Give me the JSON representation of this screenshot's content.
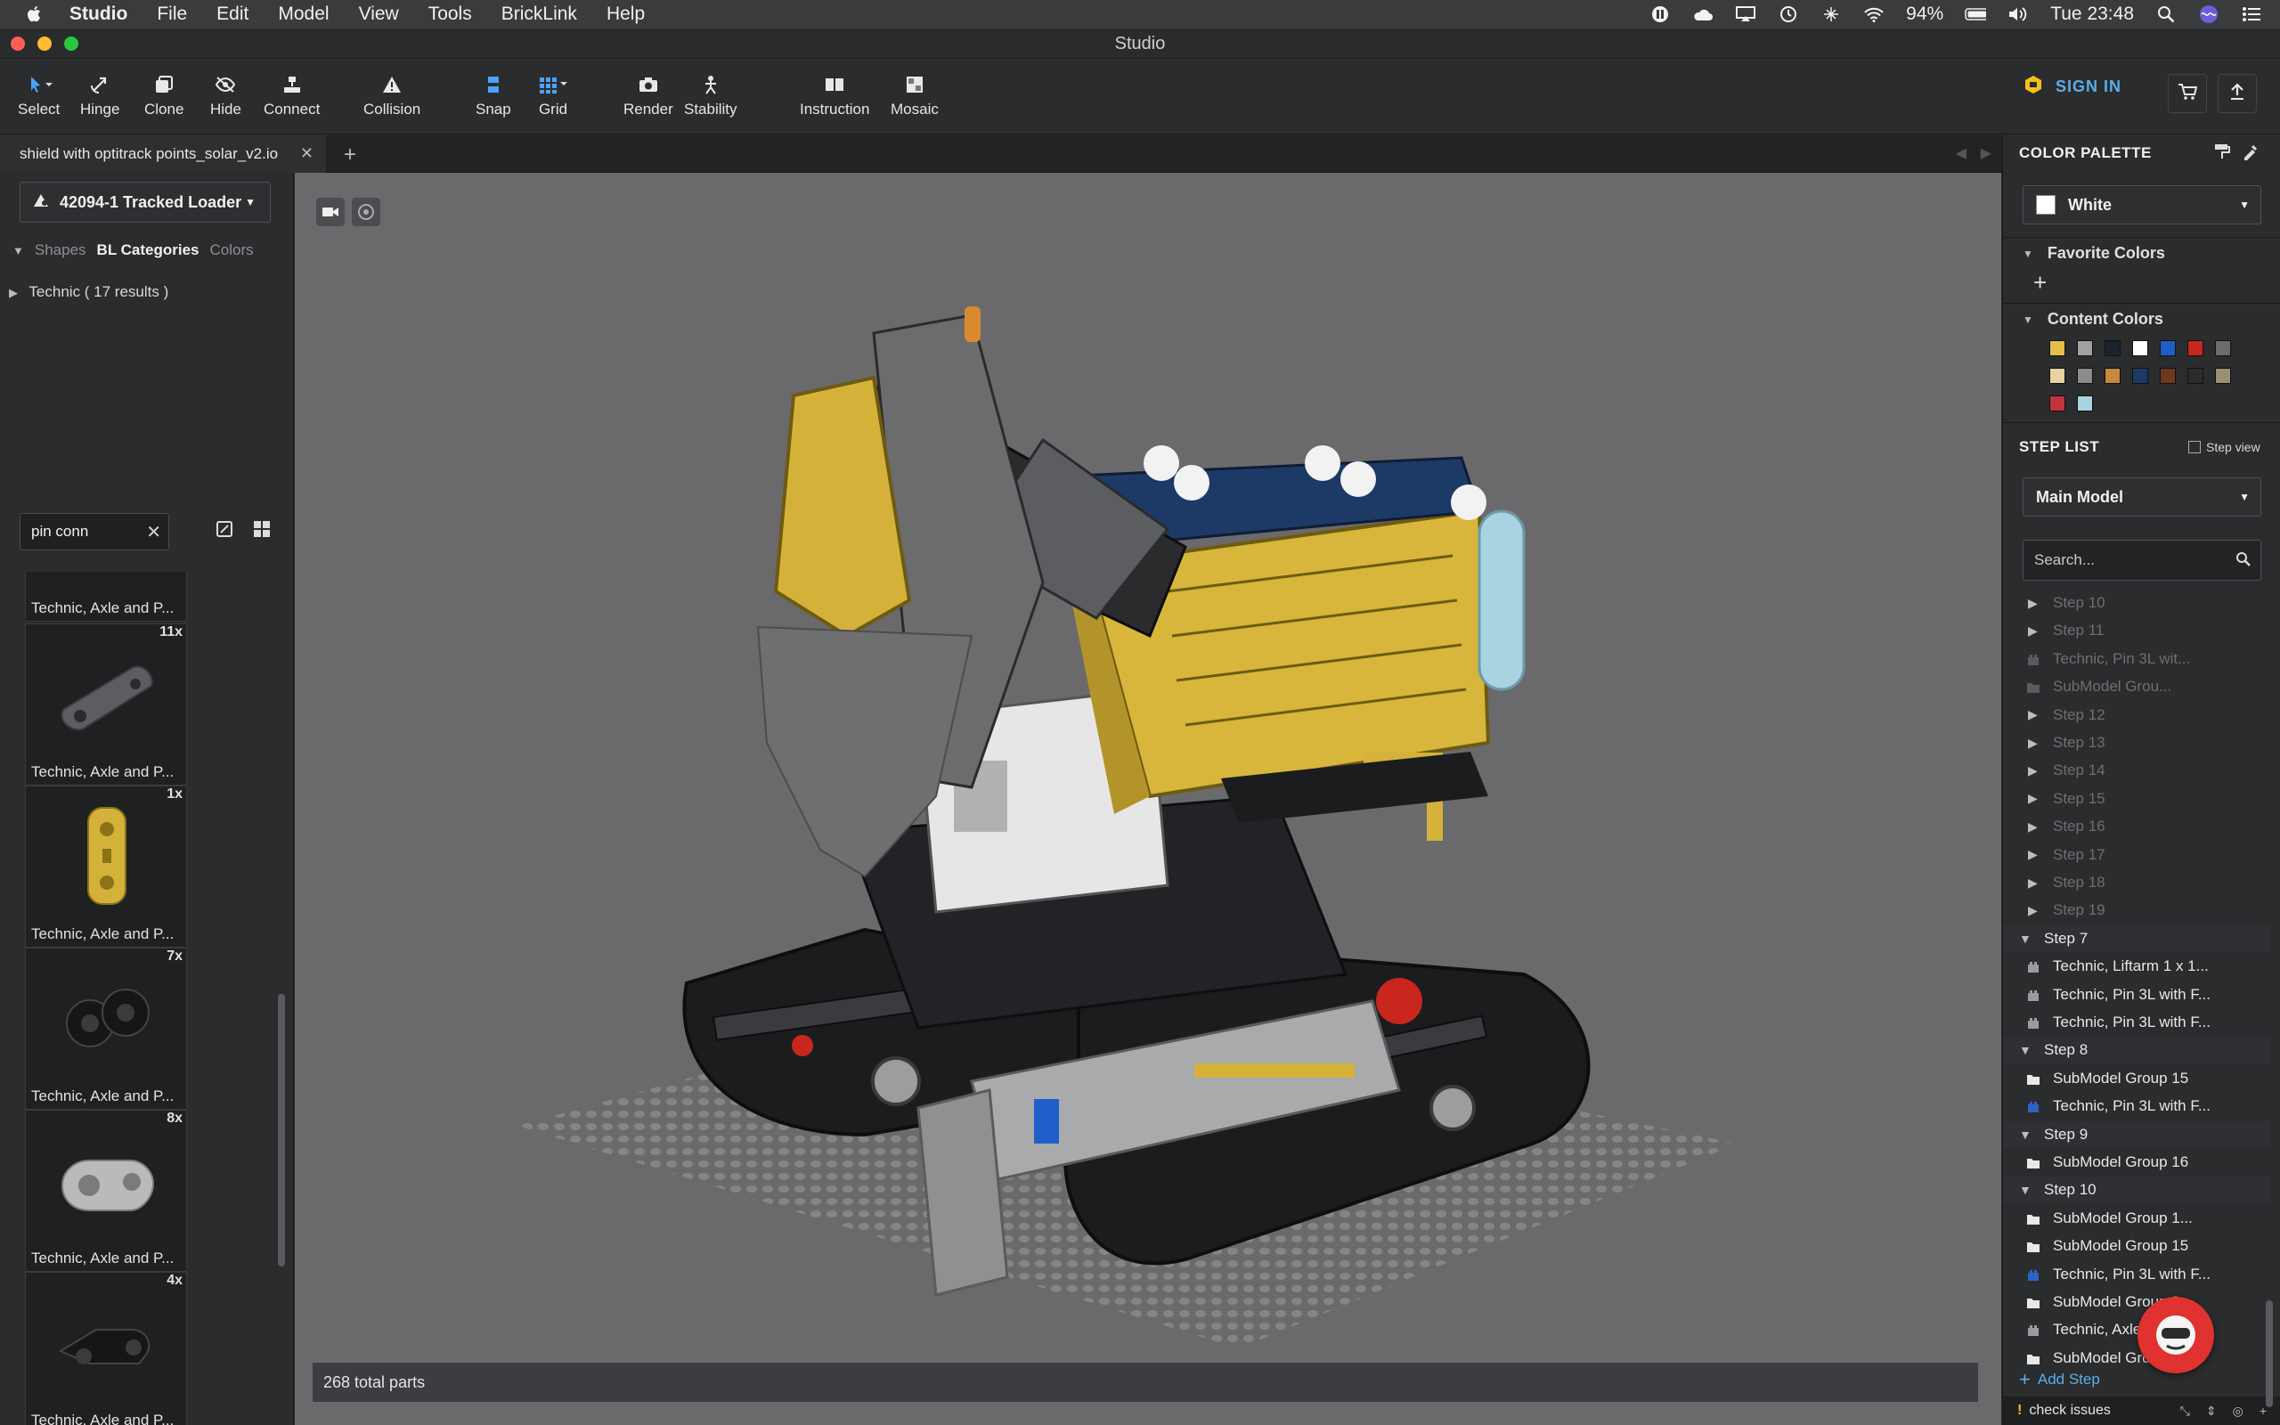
{
  "menubar": {
    "app_name": "Studio",
    "menus": [
      "File",
      "Edit",
      "Model",
      "View",
      "Tools",
      "BrickLink",
      "Help"
    ],
    "battery": "94%",
    "clock": "Tue 23:48"
  },
  "window": {
    "title": "Studio"
  },
  "toolbar": {
    "tools": [
      "Select",
      "Hinge",
      "Clone",
      "Hide",
      "Connect",
      "Collision",
      "Snap",
      "Grid",
      "Render",
      "Stability",
      "Instruction",
      "Mosaic"
    ],
    "sign_in": "SIGN IN"
  },
  "tabs": {
    "document": "shield with optitrack points_solar_v2.io"
  },
  "left_panel": {
    "set_selector": "42094-1 Tracked Loader",
    "filter_tabs": [
      "Shapes",
      "BL Categories",
      "Colors"
    ],
    "active_filter": "BL Categories",
    "category_row": "Technic ( 17 results )",
    "search_value": "pin conn",
    "parts": [
      {
        "count": "",
        "name": "Technic, Axle and P...",
        "color": "#d4b23a"
      },
      {
        "count": "11x",
        "name": "Technic, Axle and P...",
        "color": "#5c5d60"
      },
      {
        "count": "1x",
        "name": "Technic, Axle and P...",
        "color": "#d4b23a"
      },
      {
        "count": "7x",
        "name": "Technic, Axle and P...",
        "color": "#151617"
      },
      {
        "count": "8x",
        "name": "Technic, Axle and P...",
        "color": "#b9babc"
      },
      {
        "count": "4x",
        "name": "Technic, Axle and P...",
        "color": "#151617"
      }
    ]
  },
  "viewport": {
    "total_parts": "268 total parts"
  },
  "right_panel": {
    "color_palette_title": "COLOR PALETTE",
    "selected_color": "White",
    "favorite_colors": "Favorite Colors",
    "content_colors": "Content Colors",
    "swatch_colors": [
      "#e4c04a",
      "#a0a1a3",
      "#1b2330",
      "#ffffff",
      "#1f5ec9",
      "#c9261e",
      "#6b6c6e",
      "#e7d3a0",
      "#8c8c8c",
      "#c48a3e",
      "#1d3a66",
      "#6b3a1e",
      "#2a2b2d",
      "#9a8f74",
      "#c0343a",
      "#a8d3e0"
    ],
    "step_list_title": "STEP LIST",
    "step_view": "Step view",
    "model_selector": "Main Model",
    "search_placeholder": "Search...",
    "add_step": "Add Step",
    "check_issues": "check issues",
    "steps": [
      {
        "label": "Step 10",
        "kind": "step",
        "dim": true
      },
      {
        "label": "Step 11",
        "kind": "step",
        "dim": true
      },
      {
        "label": "Technic, Pin 3L wit...",
        "kind": "part",
        "dim": true
      },
      {
        "label": "SubModel Grou...",
        "kind": "group",
        "dim": true
      },
      {
        "label": "Step 12",
        "kind": "step",
        "dim": true
      },
      {
        "label": "Step 13",
        "kind": "step",
        "dim": true
      },
      {
        "label": "Step 14",
        "kind": "step",
        "dim": true
      },
      {
        "label": "Step 15",
        "kind": "step",
        "dim": true
      },
      {
        "label": "Step 16",
        "kind": "step",
        "dim": true
      },
      {
        "label": "Step 17",
        "kind": "step",
        "dim": true
      },
      {
        "label": "Step 18",
        "kind": "step",
        "dim": true
      },
      {
        "label": "Step 19",
        "kind": "step",
        "dim": true
      },
      {
        "label": "Step 7",
        "kind": "step-open",
        "dim": false
      },
      {
        "label": "Technic, Liftarm 1 x 1...",
        "kind": "part",
        "dim": false
      },
      {
        "label": "Technic, Pin 3L with F...",
        "kind": "part",
        "dim": false
      },
      {
        "label": "Technic, Pin 3L with F...",
        "kind": "part",
        "dim": false
      },
      {
        "label": "Step 8",
        "kind": "step-open",
        "dim": false
      },
      {
        "label": "SubModel Group 15",
        "kind": "group",
        "dim": false
      },
      {
        "label": "Technic, Pin 3L with F...",
        "kind": "part-blue",
        "dim": false
      },
      {
        "label": "Step 9",
        "kind": "step-open",
        "dim": false
      },
      {
        "label": "SubModel Group 16",
        "kind": "group",
        "dim": false
      },
      {
        "label": "Step 10",
        "kind": "step-open",
        "dim": false
      },
      {
        "label": "SubModel Group 1...",
        "kind": "group",
        "dim": false
      },
      {
        "label": "SubModel Group 15",
        "kind": "group",
        "dim": false
      },
      {
        "label": "Technic, Pin 3L with F...",
        "kind": "part-blue",
        "dim": false
      },
      {
        "label": "SubModel Group 8",
        "kind": "group",
        "dim": false
      },
      {
        "label": "Technic, Axle 4",
        "kind": "part",
        "dim": false
      },
      {
        "label": "SubModel Group",
        "kind": "group",
        "dim": false
      }
    ]
  }
}
